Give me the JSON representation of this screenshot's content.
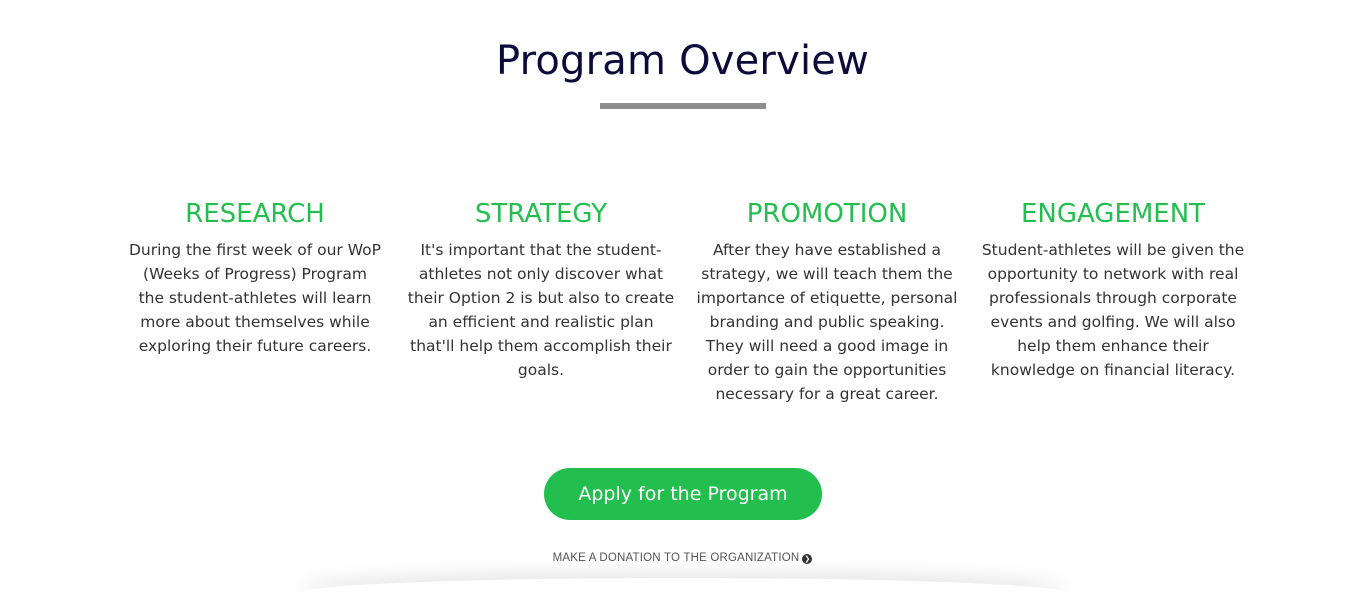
{
  "section": {
    "title": "Program Overview"
  },
  "columns": [
    {
      "heading": "RESEARCH",
      "body": "During the first week of our WoP (Weeks of Progress) Program the student-athletes will learn more about themselves while exploring their future careers."
    },
    {
      "heading": "STRATEGY",
      "body": "It's important that the student-athletes not only discover what their Option 2 is but also to create an efficient and realistic plan that'll help them accomplish their goals."
    },
    {
      "heading": "PROMOTION",
      "body": "After they have established a strategy, we will teach them the importance of etiquette, personal branding and public speaking. They will need a good image in order to gain the opportunities necessary for a great career."
    },
    {
      "heading": "ENGAGEMENT",
      "body": "Student-athletes will be given the opportunity to network with real professionals through corporate events and golfing. We will also help them enhance their knowledge on financial literacy."
    }
  ],
  "cta": {
    "apply_label": "Apply for the Program",
    "donation_label": "MAKE A DONATION TO THE ORGANIZATION",
    "donation_icon": "chevron-circle-right-icon"
  },
  "colors": {
    "accent": "#22bf4f",
    "title": "#0d0b3a",
    "underline": "#8e8e8e",
    "body_text": "#333333"
  }
}
